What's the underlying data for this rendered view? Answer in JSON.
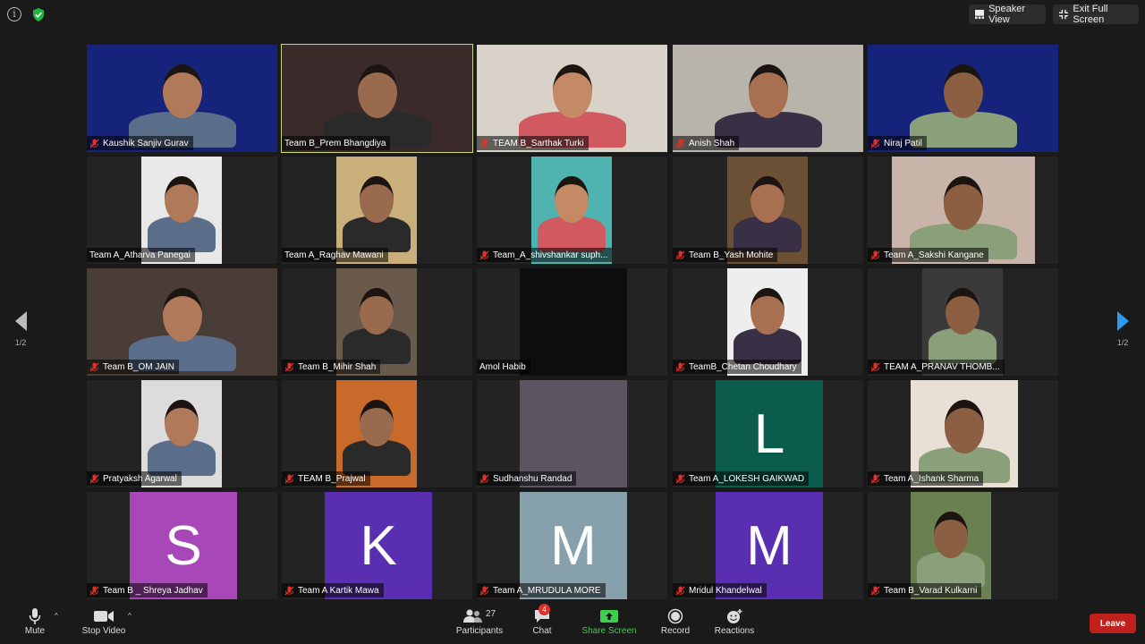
{
  "top": {
    "speaker_view_label": "Speaker View",
    "exit_full_label": "Exit Full Screen"
  },
  "pagination": {
    "left": "1/2",
    "right": "1/2"
  },
  "participants": [
    {
      "name": "Kaushik Sanjiv Gurav",
      "type": "video",
      "bg": "#15247a",
      "muted": true
    },
    {
      "name": "Team B_Prem Bhangdiya",
      "type": "video",
      "bg": "#3a2a2a",
      "muted": false,
      "active": true
    },
    {
      "name": "TEAM B_Sarthak Turki",
      "type": "video",
      "bg": "#d8d2c8",
      "muted": true
    },
    {
      "name": "Anish Shah",
      "type": "video",
      "bg": "#b8b4ac",
      "muted": true
    },
    {
      "name": "Niraj Patil",
      "type": "video",
      "bg": "#15247a",
      "muted": true
    },
    {
      "name": "Team A_Atharva Panegai",
      "type": "video",
      "bg": "#e8e8e8",
      "muted": false
    },
    {
      "name": "Team A_Raghav Mawani",
      "type": "video",
      "bg": "#c9b07a",
      "muted": false
    },
    {
      "name": "Team_A_shivshankar suph...",
      "type": "video",
      "bg": "#4fb3b0",
      "muted": true
    },
    {
      "name": "Team B_Yash Mohite",
      "type": "video",
      "bg": "#6b5036",
      "muted": true
    },
    {
      "name": "Team A_Sakshi Kangane",
      "type": "video",
      "bg": "#c8b4a8",
      "muted": true
    },
    {
      "name": "Team B_OM JAIN",
      "type": "video",
      "bg": "#4a3c36",
      "muted": true
    },
    {
      "name": "Team B_Mihir Shah",
      "type": "video",
      "bg": "#6a5a4c",
      "muted": true
    },
    {
      "name": "Amol Habib",
      "type": "video",
      "bg": "#0e0d0f",
      "muted": false
    },
    {
      "name": "TeamB_Chetan Choudhary",
      "type": "video",
      "bg": "#eeeeee",
      "muted": true
    },
    {
      "name": "TEAM A_PRANAV THOMB...",
      "type": "video",
      "bg": "#3a3a3a",
      "muted": true
    },
    {
      "name": "Pratyaksh Agarwal",
      "type": "video",
      "bg": "#dcdcdc",
      "muted": true
    },
    {
      "name": "TEAM B_Prajwal",
      "type": "video",
      "bg": "#c86a2a",
      "muted": true
    },
    {
      "name": "Sudhanshu Randad",
      "type": "video",
      "bg": "#5a5560",
      "muted": true
    },
    {
      "name": "Team A_LOKESH GAIKWAD",
      "type": "avatar",
      "letter": "L",
      "bg": "#0b5c4c",
      "muted": true
    },
    {
      "name": "Team A_Ishank Sharma",
      "type": "video",
      "bg": "#e8e0d4",
      "muted": true
    },
    {
      "name": "Team B _ Shreya Jadhav",
      "type": "avatar",
      "letter": "S",
      "bg": "#a848b8",
      "muted": true
    },
    {
      "name": "Team A Kartik Mawa",
      "type": "avatar",
      "letter": "K",
      "bg": "#5a2eb0",
      "muted": true
    },
    {
      "name": "Team A_MRUDULA MORE",
      "type": "avatar",
      "letter": "M",
      "bg": "#86a0ac",
      "muted": true
    },
    {
      "name": "Mridul Khandelwal",
      "type": "avatar",
      "letter": "M",
      "bg": "#5a2eb0",
      "muted": true
    },
    {
      "name": "Team B_Varad Kulkarni",
      "type": "video",
      "bg": "#6a8050",
      "muted": true
    }
  ],
  "toolbar": {
    "mute_label": "Mute",
    "stop_video_label": "Stop Video",
    "participants_label": "Participants",
    "participants_count": "27",
    "chat_label": "Chat",
    "chat_badge": "4",
    "share_label": "Share Screen",
    "record_label": "Record",
    "reactions_label": "Reactions",
    "leave_label": "Leave"
  },
  "colors": {
    "accent_green": "#3ecf4e",
    "leave_red": "#c0211c",
    "mute_red": "#e0302a",
    "active_border": "#c6d87a"
  },
  "icons": [
    "info-icon",
    "shield-icon",
    "speaker-view-icon",
    "exit-fullscreen-icon",
    "microphone-icon",
    "camera-icon",
    "participants-icon",
    "chat-icon",
    "share-screen-icon",
    "record-icon",
    "reactions-icon",
    "muted-mic-icon"
  ]
}
